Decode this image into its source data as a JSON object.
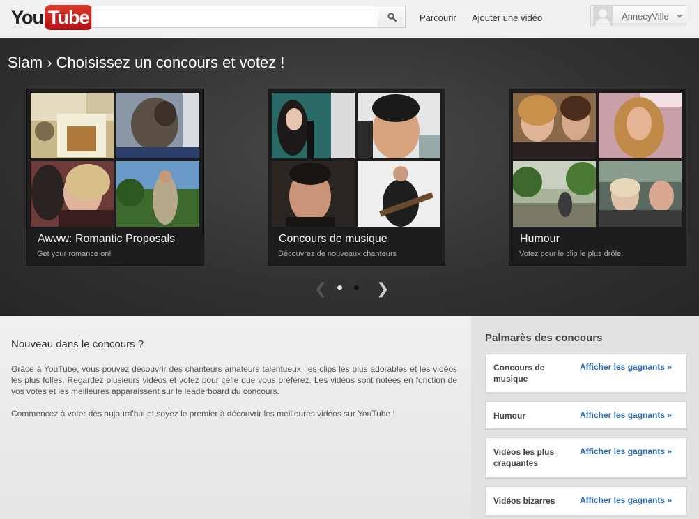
{
  "header": {
    "logo_you": "You",
    "logo_tube": "Tube",
    "search_placeholder": "",
    "search_icon": "search-icon",
    "nav": [
      "Parcourir",
      "Ajouter une vidéo"
    ],
    "user": "AnnecyVille"
  },
  "hero": {
    "title": "Slam › Choisissez un concours et votez !",
    "cards": [
      {
        "title": "Awww: Romantic Proposals",
        "subtitle": "Get your romance on!"
      },
      {
        "title": "Concours de musique",
        "subtitle": "Découvrez de nouveaux chanteurs"
      },
      {
        "title": "Humour",
        "subtitle": "Votez pour le clip le plus drôle."
      }
    ],
    "pager": {
      "prev": "❮",
      "next": "❯",
      "pages": 2,
      "active": 1
    }
  },
  "intro": {
    "heading": "Nouveau dans le concours ?",
    "p1": "Grâce à YouTube, vous pouvez découvrir des chanteurs amateurs talentueux, les clips les plus adorables et les vidéos les plus folles. Regardez plusieurs vidéos et votez pour celle que vous préférez. Les vidéos sont notées en fonction de vos votes et les meilleures apparaissent sur le leaderboard du concours.",
    "p2": "Commencez à voter dès aujourd'hui et soyez le premier à découvrir les meilleures vidéos sur YouTube !"
  },
  "side": {
    "heading": "Palmarès des concours",
    "items": [
      {
        "name": "Concours de musique",
        "link": "Afficher les gagnants »"
      },
      {
        "name": "Humour",
        "link": "Afficher les gagnants »"
      },
      {
        "name": "Vidéos les plus craquantes",
        "link": "Afficher les gagnants »"
      },
      {
        "name": "Vidéos bizarres",
        "link": "Afficher les gagnants »"
      }
    ]
  },
  "colors": {
    "brand_red": "#cc181e",
    "link_blue": "#2a6cb3"
  }
}
